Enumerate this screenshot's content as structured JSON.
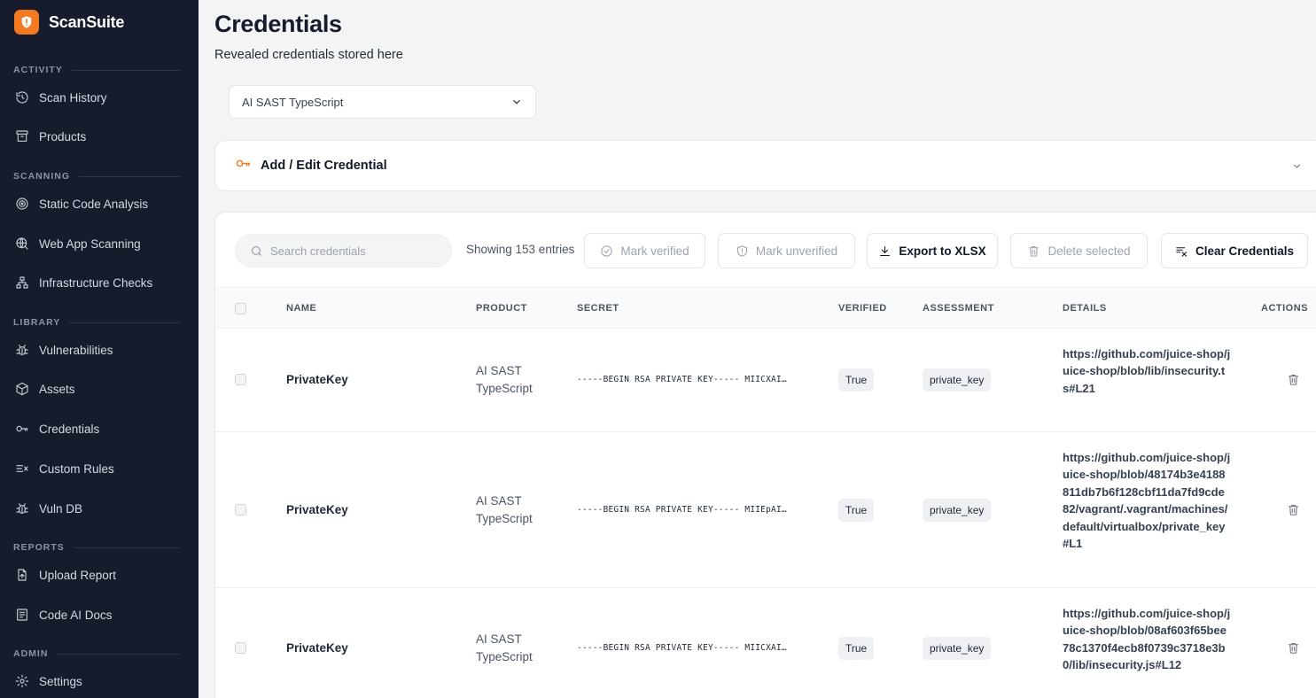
{
  "app": {
    "name": "ScanSuite"
  },
  "sidebar": {
    "sections": [
      {
        "label": "ACTIVITY"
      },
      {
        "label": "SCANNING"
      },
      {
        "label": "LIBRARY"
      },
      {
        "label": "REPORTS"
      },
      {
        "label": "ADMIN"
      }
    ],
    "items": [
      {
        "label": "Scan History",
        "icon": "history-icon"
      },
      {
        "label": "Products",
        "icon": "archive-icon"
      },
      {
        "label": "Static Code Analysis",
        "icon": "target-icon"
      },
      {
        "label": "Web App Scanning",
        "icon": "globe-search-icon"
      },
      {
        "label": "Infrastructure Checks",
        "icon": "network-icon"
      },
      {
        "label": "Vulnerabilities",
        "icon": "bug-icon"
      },
      {
        "label": "Assets",
        "icon": "cube-icon"
      },
      {
        "label": "Credentials",
        "icon": "key-icon"
      },
      {
        "label": "Custom Rules",
        "icon": "rules-icon"
      },
      {
        "label": "Vuln DB",
        "icon": "bug-icon"
      },
      {
        "label": "Upload Report",
        "icon": "file-upload-icon"
      },
      {
        "label": "Code AI Docs",
        "icon": "document-icon"
      },
      {
        "label": "Settings",
        "icon": "gear-icon"
      }
    ]
  },
  "page": {
    "title": "Credentials",
    "subtitle": "Revealed credentials stored here",
    "product_select": {
      "value": "AI SAST TypeScript"
    }
  },
  "edit_panel": {
    "title": "Add / Edit Credential"
  },
  "toolbar": {
    "search_placeholder": "Search credentials",
    "entries_text": "Showing 153 entries",
    "mark_verified": "Mark verified",
    "mark_unverified": "Mark unverified",
    "export": "Export to XLSX",
    "delete_selected": "Delete selected",
    "clear": "Clear Credentials"
  },
  "table": {
    "columns": {
      "name": "NAME",
      "product": "PRODUCT",
      "secret": "SECRET",
      "verified": "VERIFIED",
      "assessment": "ASSESSMENT",
      "details": "DETAILS",
      "actions": "ACTIONS"
    },
    "rows": [
      {
        "name": "PrivateKey",
        "product": "AI SAST TypeScript",
        "secret": "-----BEGIN RSA PRIVATE KEY----- MIICXAI…",
        "verified": "True",
        "assessment": "private_key",
        "details": "https://github.com/juice-shop/juice-shop/blob/lib/insecurity.ts#L21"
      },
      {
        "name": "PrivateKey",
        "product": "AI SAST TypeScript",
        "secret": "-----BEGIN RSA PRIVATE KEY----- MIIEpAI…",
        "verified": "True",
        "assessment": "private_key",
        "details": "https://github.com/juice-shop/juice-shop/blob/48174b3e4188811db7b6f128cbf11da7fd9cde82/vagrant/.vagrant/machines/default/virtualbox/private_key#L1"
      },
      {
        "name": "PrivateKey",
        "product": "AI SAST TypeScript",
        "secret": "-----BEGIN RSA PRIVATE KEY----- MIICXAI…",
        "verified": "True",
        "assessment": "private_key",
        "details": "https://github.com/juice-shop/juice-shop/blob/08af603f65bee78c1370f4ecb8f0739c3718e3b0/lib/insecurity.js#L12"
      }
    ]
  },
  "colors": {
    "accent": "#f47a22",
    "sidebar_bg": "#161c2c",
    "page_bg": "#f3f4f6"
  }
}
